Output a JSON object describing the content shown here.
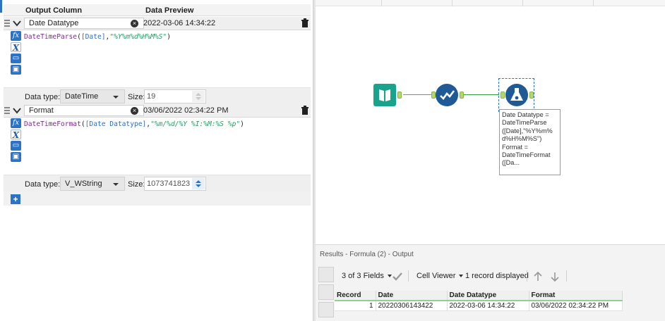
{
  "formula_panel": {
    "headers": {
      "output_column": "Output Column",
      "data_preview": "Data Preview"
    },
    "fields": [
      {
        "name": "Date Datatype",
        "preview": "2022-03-06 14:34:22",
        "expression": {
          "fn": "DateTimeParse",
          "open": "(",
          "arg": "[Date]",
          "comma": ",",
          "str": "\"%Y%m%d%H%M%S\"",
          "close": ")"
        },
        "data_type_label": "Data type:",
        "data_type": "DateTime",
        "size_label": "Size:",
        "size": "19"
      },
      {
        "name": "Format",
        "preview": "03/06/2022 02:34:22 PM",
        "expression": {
          "fn": "DateTimeFormat",
          "open": "(",
          "arg": "[Date Datatype]",
          "comma": ",",
          "str": "\"%m/%d/%Y %I:%M:%S %p\"",
          "close": ")"
        },
        "data_type_label": "Data type:",
        "data_type": "V_WString",
        "size_label": "Size:",
        "size": "1073741823"
      }
    ],
    "add_button": "+"
  },
  "canvas": {
    "annotation_lines": [
      "Date Datatype =",
      "DateTimeParse",
      "([Date],\"%Y%m%",
      "d%H%M%S\")",
      "Format =",
      "DateTimeFormat",
      "([Da..."
    ],
    "colors": {
      "input_tool": "#1aa38c",
      "select_tool": "#1f5a96",
      "formula_tool": "#1f5a96",
      "connector": "#2ea043",
      "anchor": "#b5d86a"
    }
  },
  "results": {
    "title": "Results - Formula (2) - Output",
    "fields_label": "3 of 3 Fields",
    "cell_viewer_label": "Cell Viewer",
    "records_label": "1 record displayed",
    "columns": [
      "Record",
      "Date",
      "Date Datatype",
      "Format"
    ],
    "rows": [
      [
        "1",
        "20220306143422",
        "2022-03-06 14:34:22",
        "03/06/2022 02:34:22 PM"
      ]
    ]
  }
}
